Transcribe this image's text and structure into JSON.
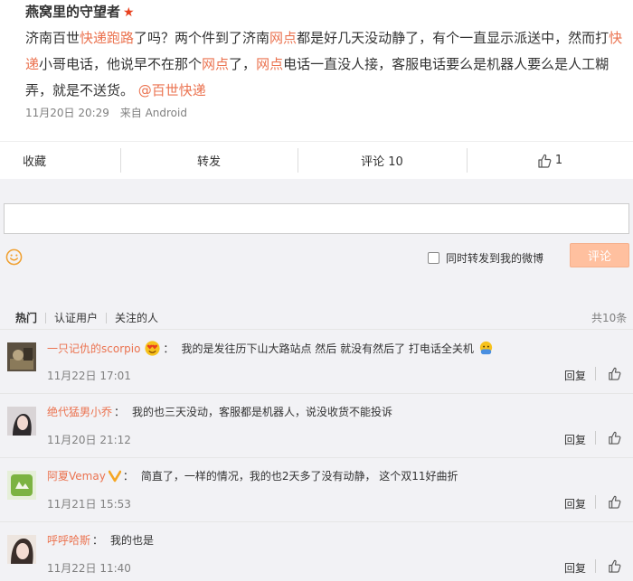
{
  "post": {
    "author": "燕窝里的守望者",
    "vip_star": "★",
    "text_1": "济南百世",
    "text_kw1": "快递跑路",
    "text_2": "了吗？两个件到了济南",
    "text_kw2": "网点",
    "text_3": "都是好几天没动静了，有个一直显示派送中，然而打",
    "text_kw3": "快递",
    "text_4": "小哥电话，他说早不在那个",
    "text_kw4": "网点",
    "text_5": "了，",
    "text_kw5": "网点",
    "text_6": "电话一直没人接，客服电话要么是机器人要么是人工糊弄，就是不送货。",
    "mention": "@百世快递",
    "time": "11月20日 20:29",
    "source": "来自 Android"
  },
  "actions": {
    "collect": "收藏",
    "repost": "转发",
    "comment": "评论 10",
    "like_count": "1"
  },
  "composer": {
    "input_value": "",
    "repost_label": "同时转发到我的微博",
    "submit_label": "评论",
    "submit_color": "#ffc09f"
  },
  "filters": {
    "tabs": [
      "热门",
      "认证用户",
      "关注的人"
    ],
    "total": "共10条"
  },
  "comments": [
    {
      "user": "一只记仇的scorpio",
      "badge_icon": "heart-eyes-emoji",
      "text": "我的是发往历下山大路站点 然后 就没有然后了 打电话全关机",
      "trailing_icon": "facepalm-emoji",
      "time": "11月22日 17:01",
      "reply": "回复"
    },
    {
      "user": "绝代猛男小乔",
      "text": "我的也三天没动，客服都是机器人，说没收货不能投诉",
      "time": "11月20日 21:12",
      "reply": "回复"
    },
    {
      "user": "阿夏Vemay",
      "badge_icon": "verified-v-icon",
      "text": "简直了，一样的情况，我的也2天多了没有动静， 这个双11好曲折",
      "time": "11月21日 15:53",
      "reply": "回复"
    },
    {
      "user": "呼呼哈斯",
      "text": "我的也是",
      "time": "11月22日 11:40",
      "reply": "回复"
    }
  ],
  "colors": {
    "accent": "#eb7350",
    "background_gray": "#f2f2f5",
    "star": "#e8411f"
  }
}
